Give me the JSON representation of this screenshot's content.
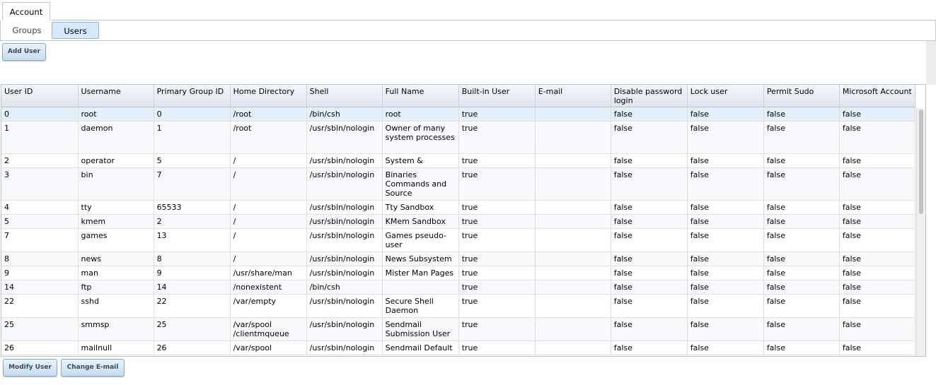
{
  "top_tabs": [
    {
      "label": "Account"
    }
  ],
  "sub_tabs": [
    {
      "label": "Groups"
    },
    {
      "label": "Users"
    }
  ],
  "buttons": {
    "add_user": "Add User",
    "modify_user": "Modify User",
    "change_email": "Change E-mail"
  },
  "table": {
    "columns": [
      "User ID",
      "Username",
      "Primary Group ID",
      "Home Directory",
      "Shell",
      "Full Name",
      "Built-in User",
      "E-mail",
      "Disable password login",
      "Lock user",
      "Permit Sudo",
      "Microsoft Account"
    ],
    "rows": [
      [
        "0",
        "root",
        "0",
        "/root",
        "/bin/csh",
        "root",
        "true",
        "",
        "false",
        "false",
        "false",
        "false"
      ],
      [
        "1",
        "daemon",
        "1",
        "/root",
        "/usr/sbin/nologin",
        "Owner of many system processes",
        "true",
        "",
        "false",
        "false",
        "false",
        "false"
      ],
      [
        "2",
        "operator",
        "5",
        "/",
        "/usr/sbin/nologin",
        "System &",
        "true",
        "",
        "false",
        "false",
        "false",
        "false"
      ],
      [
        "3",
        "bin",
        "7",
        "/",
        "/usr/sbin/nologin",
        "Binaries Commands and Source",
        "true",
        "",
        "false",
        "false",
        "false",
        "false"
      ],
      [
        "4",
        "tty",
        "65533",
        "/",
        "/usr/sbin/nologin",
        "Tty Sandbox",
        "true",
        "",
        "false",
        "false",
        "false",
        "false"
      ],
      [
        "5",
        "kmem",
        "2",
        "/",
        "/usr/sbin/nologin",
        "KMem Sandbox",
        "true",
        "",
        "false",
        "false",
        "false",
        "false"
      ],
      [
        "7",
        "games",
        "13",
        "/",
        "/usr/sbin/nologin",
        "Games pseudo-user",
        "true",
        "",
        "false",
        "false",
        "false",
        "false"
      ],
      [
        "8",
        "news",
        "8",
        "/",
        "/usr/sbin/nologin",
        "News Subsystem",
        "true",
        "",
        "false",
        "false",
        "false",
        "false"
      ],
      [
        "9",
        "man",
        "9",
        "/usr/share/man",
        "/usr/sbin/nologin",
        "Mister Man Pages",
        "true",
        "",
        "false",
        "false",
        "false",
        "false"
      ],
      [
        "14",
        "ftp",
        "14",
        "/nonexistent",
        "/bin/csh",
        "",
        "true",
        "",
        "false",
        "false",
        "false",
        "false"
      ],
      [
        "22",
        "sshd",
        "22",
        "/var/empty",
        "/usr/sbin/nologin",
        "Secure Shell Daemon",
        "true",
        "",
        "false",
        "false",
        "false",
        "false"
      ],
      [
        "25",
        "smmsp",
        "25",
        "/var/spool /clientmqueue",
        "/usr/sbin/nologin",
        "Sendmail Submission User",
        "true",
        "",
        "false",
        "false",
        "false",
        "false"
      ],
      [
        "26",
        "mailnull",
        "26",
        "/var/spool",
        "/usr/sbin/nologin",
        "Sendmail Default",
        "true",
        "",
        "false",
        "false",
        "false",
        "false"
      ]
    ],
    "selected_row": 0
  }
}
